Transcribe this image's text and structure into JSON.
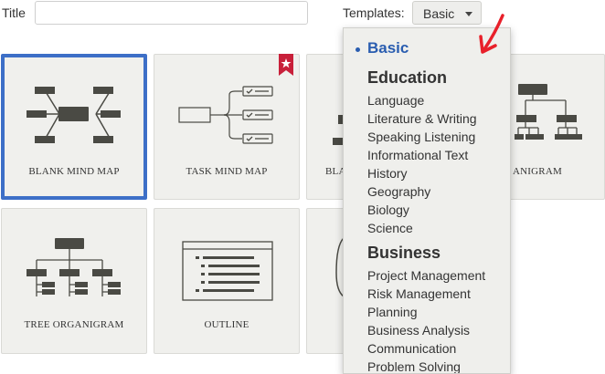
{
  "form": {
    "title_label": "Title",
    "title_value": "",
    "templates_label": "Templates:",
    "templates_selected": "Basic"
  },
  "cards": [
    {
      "label": "BLANK MIND MAP",
      "selected": true
    },
    {
      "label": "TASK MIND MAP",
      "badge": "star-bookmark"
    },
    {
      "label": "BLA"
    },
    {
      "label": "ANIGRAM"
    },
    {
      "label": "TREE ORGANIGRAM"
    },
    {
      "label": "OUTLINE"
    }
  ],
  "dropdown": {
    "active": "Basic",
    "groups": [
      {
        "heading": "Education",
        "items": [
          "Language",
          "Literature & Writing",
          "Speaking Listening",
          "Informational Text",
          "History",
          "Geography",
          "Biology",
          "Science"
        ]
      },
      {
        "heading": "Business",
        "items": [
          "Project Management",
          "Risk Management",
          "Planning",
          "Business Analysis",
          "Communication",
          "Problem Solving"
        ]
      }
    ]
  },
  "colors": {
    "accent": "#3d6fc7",
    "annotation_arrow": "#e8202a",
    "icon": "#4a4a44"
  }
}
